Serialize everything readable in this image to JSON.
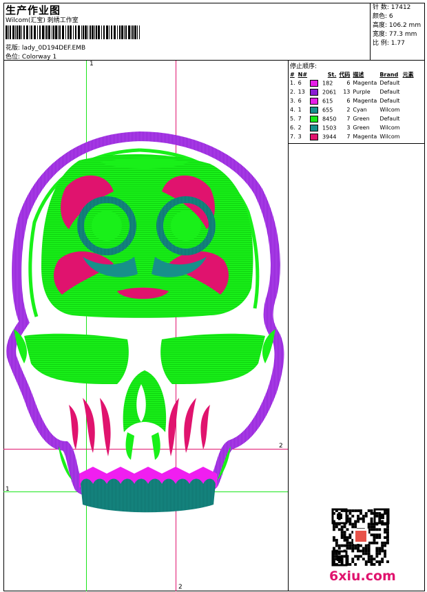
{
  "header": {
    "title": "生产作业图",
    "company": "Wilcom(汇宝) 刺绣工作室",
    "design_label": "花版:",
    "design_value": "lady_0D194DEF.EMB",
    "colorway_label": "色位:",
    "colorway_value": "Colorway 1"
  },
  "stats": [
    {
      "label": "针 数:",
      "value": "17412"
    },
    {
      "label": "颜色:",
      "value": "6"
    },
    {
      "label": "高度:",
      "value": "106.2 mm"
    },
    {
      "label": "宽度:",
      "value": "77.3 mm"
    },
    {
      "label": "比 例:",
      "value": "1.77"
    }
  ],
  "stop_sequence": {
    "title": "停止顺序:",
    "columns": [
      "#",
      "N#",
      "St.",
      "代码",
      "描述",
      "Brand",
      "元素"
    ],
    "rows": [
      {
        "idx": "1.",
        "n": "6",
        "color": "#e61ee6",
        "st": "182",
        "code": "6",
        "desc": "Magenta",
        "brand": "Default"
      },
      {
        "idx": "2.",
        "n": "13",
        "color": "#8a1ed2",
        "st": "2061",
        "code": "13",
        "desc": "Purple",
        "brand": "Default"
      },
      {
        "idx": "3.",
        "n": "6",
        "color": "#e61ee6",
        "st": "615",
        "code": "6",
        "desc": "Magenta",
        "brand": "Default"
      },
      {
        "idx": "4.",
        "n": "1",
        "color": "#17908a",
        "st": "655",
        "code": "2",
        "desc": "Cyan",
        "brand": "Wilcom"
      },
      {
        "idx": "5.",
        "n": "7",
        "color": "#19e619",
        "st": "8450",
        "code": "7",
        "desc": "Green",
        "brand": "Default"
      },
      {
        "idx": "6.",
        "n": "2",
        "color": "#17908a",
        "st": "1503",
        "code": "3",
        "desc": "Green",
        "brand": "Wilcom"
      },
      {
        "idx": "7.",
        "n": "3",
        "color": "#e0136e",
        "st": "3944",
        "code": "7",
        "desc": "Magenta",
        "brand": "Wilcom"
      }
    ]
  },
  "guides": {
    "v1": "1",
    "v2": "2",
    "h1": "1",
    "h2": "2"
  },
  "watermark": "6xiu.com",
  "colors": {
    "purple": "#8a1ed2",
    "green": "#19f019",
    "magenta": "#e0136e",
    "teal": "#17908a",
    "pink": "#f01ef0"
  }
}
